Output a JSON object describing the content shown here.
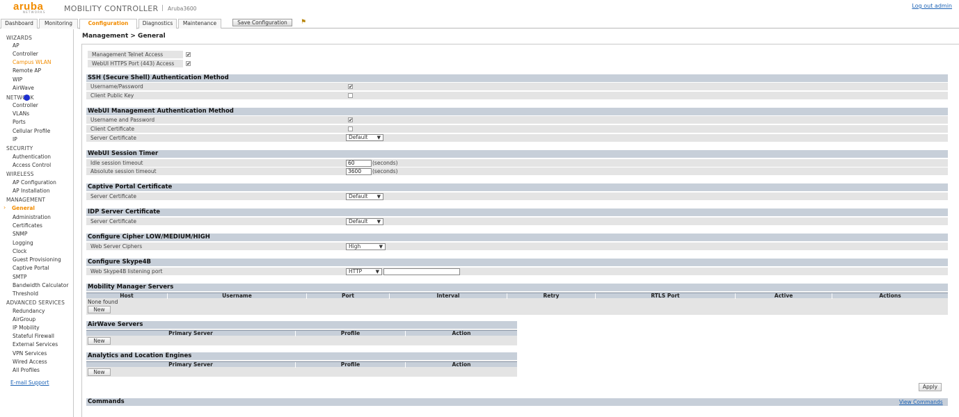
{
  "header": {
    "logo": "aruba",
    "logo_sub": "NETWORKS",
    "title": "MOBILITY CONTROLLER",
    "sep": "|",
    "host": "Aruba3600",
    "logout": "Log out admin"
  },
  "tabs": {
    "dashboard": "Dashboard",
    "monitoring": "Monitoring",
    "configuration": "Configuration",
    "diagnostics": "Diagnostics",
    "maintenance": "Maintenance",
    "save": "Save Configuration"
  },
  "sidebar": {
    "wizards": "WIZARDS",
    "ap": "AP",
    "controller": "Controller",
    "campus_wlan": "Campus WLAN",
    "remote_ap": "Remote AP",
    "wip": "WIP",
    "airwave": "AirWave",
    "network": "NETWORK",
    "net_controller": "Controller",
    "vlans": "VLANs",
    "ports": "Ports",
    "cellular": "Cellular Profile",
    "ip": "IP",
    "security": "SECURITY",
    "authentication": "Authentication",
    "access_control": "Access Control",
    "wireless": "WIRELESS",
    "ap_configuration": "AP Configuration",
    "ap_installation": "AP Installation",
    "management": "MANAGEMENT",
    "general": "General",
    "administration": "Administration",
    "certificates": "Certificates",
    "snmp": "SNMP",
    "logging": "Logging",
    "clock": "Clock",
    "guest_provisioning": "Guest Provisioning",
    "captive_portal": "Captive Portal",
    "smtp": "SMTP",
    "bandwidth_calculator": "Bandwidth Calculator",
    "threshold": "Threshold",
    "advanced_services": "ADVANCED SERVICES",
    "redundancy": "Redundancy",
    "airgroup": "AirGroup",
    "ip_mobility": "IP Mobility",
    "stateful_firewall": "Stateful Firewall",
    "external_services": "External Services",
    "vpn_services": "VPN Services",
    "wired_access": "Wired Access",
    "all_profiles": "All Profiles",
    "email_support": "E-mail Support"
  },
  "main": {
    "title": "Management > General",
    "telnet_label": "Management Telnet Access",
    "telnet_checked": true,
    "webui_https_label": "WebUI HTTPS Port (443) Access",
    "webui_https_checked": true,
    "ssh": {
      "title": "SSH (Secure Shell) Authentication Method",
      "username_password": "Username/Password",
      "username_password_checked": true,
      "client_public_key": "Client Public Key",
      "client_public_key_checked": false
    },
    "webui_auth": {
      "title": "WebUI Management Authentication Method",
      "username_and_password": "Username and Password",
      "username_and_password_checked": true,
      "client_certificate": "Client Certificate",
      "client_certificate_checked": false,
      "server_certificate": "Server Certificate",
      "server_certificate_value": "Default"
    },
    "session_timer": {
      "title": "WebUI Session Timer",
      "idle_label": "Idle session timeout",
      "idle_value": "60",
      "absolute_label": "Absolute session timeout",
      "absolute_value": "3600",
      "unit": "(seconds)"
    },
    "captive_portal": {
      "title": "Captive Portal Certificate",
      "server_certificate": "Server Certificate",
      "value": "Default"
    },
    "idp": {
      "title": "IDP Server Certificate",
      "server_certificate": "Server Certificate",
      "value": "Default"
    },
    "cipher": {
      "title": "Configure Cipher LOW/MEDIUM/HIGH",
      "web_server_ciphers": "Web Server Ciphers",
      "value": "High"
    },
    "skype": {
      "title": "Configure Skype4B",
      "listening_port": "Web Skype4B listening port",
      "protocol": "HTTP",
      "port_value": ""
    },
    "mobility_manager": {
      "title": "Mobility Manager Servers",
      "columns": [
        "Host",
        "Username",
        "Port",
        "Interval",
        "Retry",
        "RTLS Port",
        "Active",
        "Actions"
      ],
      "none_found": "None found",
      "new": "New"
    },
    "airwave": {
      "title": "AirWave Servers",
      "columns": [
        "Primary Server",
        "Profile",
        "Action"
      ],
      "new": "New"
    },
    "analytics": {
      "title": "Analytics and Location Engines",
      "columns": [
        "Primary Server",
        "Profile",
        "Action"
      ],
      "new": "New"
    },
    "apply": "Apply",
    "commands": "Commands",
    "view_commands": "View Commands"
  }
}
